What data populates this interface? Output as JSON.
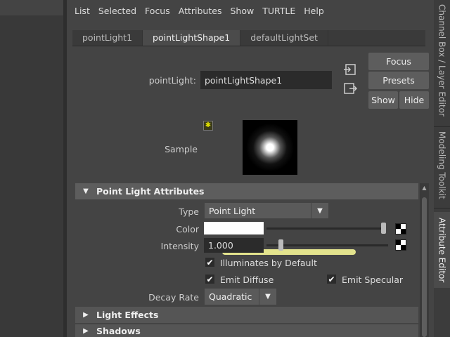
{
  "menu": [
    "List",
    "Selected",
    "Focus",
    "Attributes",
    "Show",
    "TURTLE",
    "Help"
  ],
  "tabs": [
    "pointLight1",
    "pointLightShape1",
    "defaultLightSet"
  ],
  "node": {
    "type_label": "pointLight:",
    "name_value": "pointLightShape1"
  },
  "buttons": {
    "focus": "Focus",
    "presets": "Presets",
    "show": "Show",
    "hide": "Hide"
  },
  "sample_label": "Sample",
  "sections": {
    "point_light": "Point Light Attributes",
    "light_effects": "Light Effects",
    "shadows": "Shadows"
  },
  "attributes": {
    "type_label": "Type",
    "type_value": "Point Light",
    "color_label": "Color",
    "color_value": "#ffffff",
    "color_slider_fraction": 1.0,
    "intensity_label": "Intensity",
    "intensity_value": "1.000",
    "intensity_slider_fraction": 0.1,
    "illuminates_label": "Illuminates by Default",
    "illuminates_checked": true,
    "emit_diffuse_label": "Emit Diffuse",
    "emit_diffuse_checked": true,
    "emit_specular_label": "Emit Specular",
    "emit_specular_checked": true,
    "decay_label": "Decay Rate",
    "decay_value": "Quadratic"
  },
  "side_tabs": [
    "Channel Box / Layer Editor",
    "Modeling Toolkit",
    "Attribute Editor"
  ],
  "accent_highlight": "#ffff9a"
}
